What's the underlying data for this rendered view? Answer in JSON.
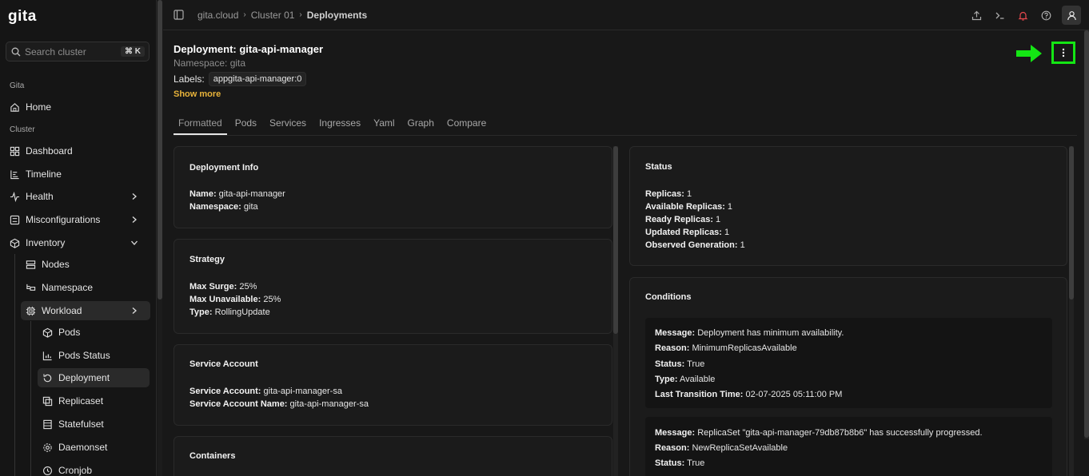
{
  "app": {
    "logo": "gita"
  },
  "search": {
    "placeholder": "Search cluster",
    "shortcut": "⌘ K"
  },
  "sidebar": {
    "section_gita": "Gita",
    "section_cluster": "Cluster",
    "home": "Home",
    "dashboard": "Dashboard",
    "timeline": "Timeline",
    "health": "Health",
    "misconfigurations": "Misconfigurations",
    "inventory": "Inventory",
    "nodes": "Nodes",
    "namespace": "Namespace",
    "workload": "Workload",
    "pods": "Pods",
    "pods_status": "Pods Status",
    "deployment": "Deployment",
    "replicaset": "Replicaset",
    "statefulset": "Statefulset",
    "daemonset": "Daemonset",
    "cronjob": "Cronjob"
  },
  "breadcrumb": {
    "item1": "gita.cloud",
    "item2": "Cluster 01",
    "item3": "Deployments"
  },
  "header": {
    "title": "Deployment: gita-api-manager",
    "namespace": "Namespace: gita",
    "labels_label": "Labels:",
    "label_chip": "appgita-api-manager:0",
    "show_more": "Show more"
  },
  "tabs": [
    "Formatted",
    "Pods",
    "Services",
    "Ingresses",
    "Yaml",
    "Graph",
    "Compare"
  ],
  "deployment_info": {
    "title": "Deployment Info",
    "name_key": "Name:",
    "name_val": " gita-api-manager",
    "ns_key": "Namespace:",
    "ns_val": " gita"
  },
  "strategy": {
    "title": "Strategy",
    "surge_key": "Max Surge:",
    "surge_val": " 25%",
    "unavail_key": "Max Unavailable:",
    "unavail_val": " 25%",
    "type_key": "Type:",
    "type_val": " RollingUpdate"
  },
  "service_account": {
    "title": "Service Account",
    "sa_key": "Service Account:",
    "sa_val": " gita-api-manager-sa",
    "san_key": "Service Account Name:",
    "san_val": " gita-api-manager-sa"
  },
  "containers": {
    "title": "Containers"
  },
  "status": {
    "title": "Status",
    "replicas_key": "Replicas:",
    "replicas_val": " 1",
    "avail_key": "Available Replicas:",
    "avail_val": " 1",
    "ready_key": "Ready Replicas:",
    "ready_val": " 1",
    "updated_key": "Updated Replicas:",
    "updated_val": " 1",
    "observed_key": "Observed Generation:",
    "observed_val": " 1"
  },
  "conditions": {
    "title": "Conditions",
    "items": [
      {
        "message_key": "Message:",
        "message_val": " Deployment has minimum availability.",
        "reason_key": "Reason:",
        "reason_val": " MinimumReplicasAvailable",
        "status_key": "Status:",
        "status_val": " True",
        "type_key": "Type:",
        "type_val": " Available",
        "ltt_key": "Last Transition Time:",
        "ltt_val": " 02-07-2025 05:11:00 PM"
      },
      {
        "message_key": "Message:",
        "message_val": " ReplicaSet \"gita-api-manager-79db87b8b6\" has successfully progressed.",
        "reason_key": "Reason:",
        "reason_val": " NewReplicaSetAvailable",
        "status_key": "Status:",
        "status_val": " True"
      }
    ]
  },
  "colors": {
    "accent": "#e8b33a",
    "highlight": "#14e614",
    "alert": "#e5484d"
  }
}
